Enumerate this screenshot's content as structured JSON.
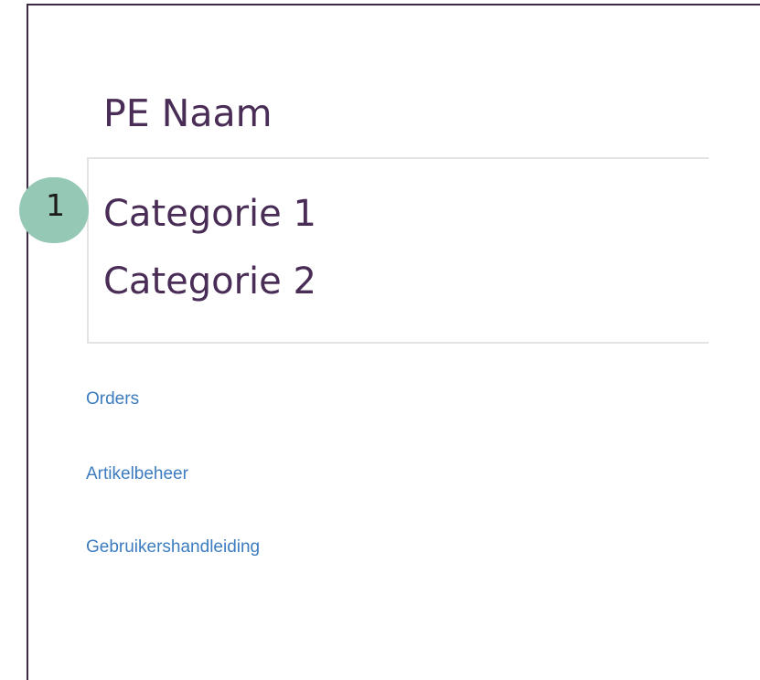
{
  "header": {
    "pe_name": "PE Naam"
  },
  "categories": [
    {
      "label": "Categorie 1"
    },
    {
      "label": "Categorie 2"
    }
  ],
  "annotation": {
    "marker_number": "1",
    "marker_color": "#96c8b6"
  },
  "nav": {
    "links": [
      {
        "label": "Orders"
      },
      {
        "label": "Artikelbeheer"
      },
      {
        "label": "Gebruikershandleiding"
      }
    ]
  },
  "colors": {
    "title_text": "#4a2d56",
    "link_text": "#3c7cbf",
    "frame_border": "#3d2a44",
    "divider": "#e3e3e3"
  }
}
